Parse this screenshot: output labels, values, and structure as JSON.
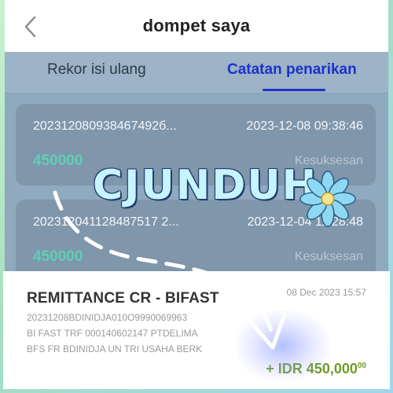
{
  "header": {
    "title": "dompet saya",
    "back_icon": "chevron-left-icon"
  },
  "tabs": [
    {
      "label": "Rekor isi ulang",
      "active": false
    },
    {
      "label": "Catatan penarikan",
      "active": true
    }
  ],
  "records": [
    {
      "id": "202312080938467492б...",
      "date": "2023-12-08 09:38:46",
      "amount": "450000",
      "status": "Kesuksesan"
    },
    {
      "id": "202312041128487517 2...",
      "date": "2023-12-04 11:28:48",
      "amount": "450000",
      "status": "Kesuksesan"
    }
  ],
  "notification": {
    "title": "REMITTANCE CR - BIFAST",
    "date": "08 Dec 2023 15:57",
    "lines": [
      "20231208BDINIDJA010O9990069963",
      "BI FAST TRF 000140602147 PTDELIMA",
      "BFS FR BDINIDJA UN TRI USAHA BERK"
    ],
    "amount": "+ IDR 450,000",
    "amount_cents": "00"
  },
  "watermark": {
    "text": "CJUNDUH"
  },
  "colors": {
    "accent": "#1d32c9",
    "amount": "#5ed0b4",
    "credit": "#6e9b2a"
  }
}
